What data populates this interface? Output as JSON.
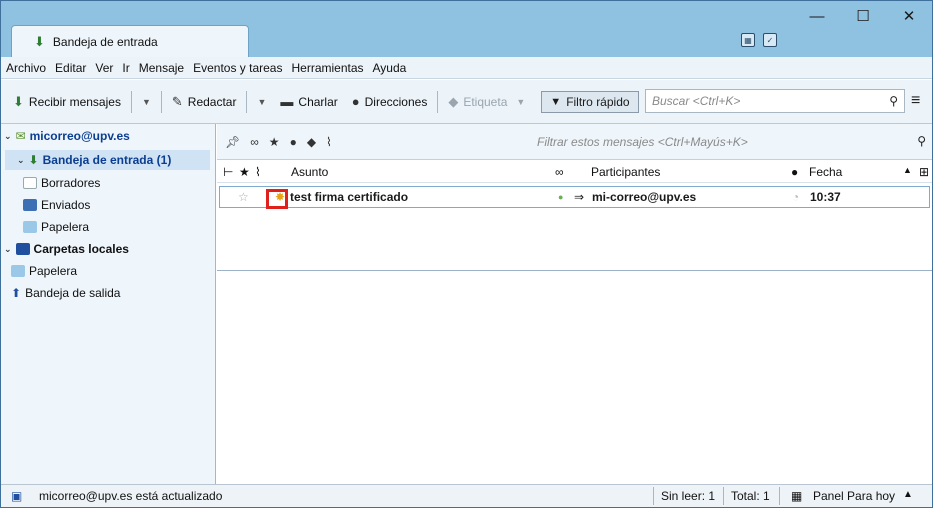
{
  "window": {
    "tab_title": "Bandeja de entrada",
    "controls": {
      "minimize": "—",
      "maximize": "☐",
      "close": "✕"
    }
  },
  "menu": [
    "Archivo",
    "Editar",
    "Ver",
    "Ir",
    "Mensaje",
    "Eventos y tareas",
    "Herramientas",
    "Ayuda"
  ],
  "toolbar": {
    "get_messages": "Recibir mensajes",
    "compose": "Redactar",
    "chat": "Charlar",
    "address_book": "Direcciones",
    "tag": "Etiqueta",
    "quick_filter": "Filtro rápido",
    "search_placeholder": "Buscar <Ctrl+K>"
  },
  "folders": {
    "account": "micorreo@upv.es",
    "inbox": "Bandeja de entrada (1)",
    "drafts": "Borradores",
    "sent": "Enviados",
    "trash": "Papelera",
    "local_folders": "Carpetas locales",
    "local_trash": "Papelera",
    "outbox": "Bandeja de salida"
  },
  "message_list": {
    "filter_placeholder": "Filtrar estos mensajes <Ctrl+Mayús+K>",
    "columns": {
      "subject": "Asunto",
      "participants": "Participantes",
      "date": "Fecha"
    },
    "rows": [
      {
        "subject": "test firma certificado",
        "participant": "mi-correo@upv.es",
        "date": "10:37"
      }
    ]
  },
  "statusbar": {
    "message": "micorreo@upv.es está actualizado",
    "unread": "Sin leer: 1",
    "total": "Total: 1",
    "today_pane": "Panel Para hoy"
  },
  "colors": {
    "titlebar": "#8fc1e0",
    "highlight": "#e0201a",
    "selection": "#cfe3f4"
  }
}
